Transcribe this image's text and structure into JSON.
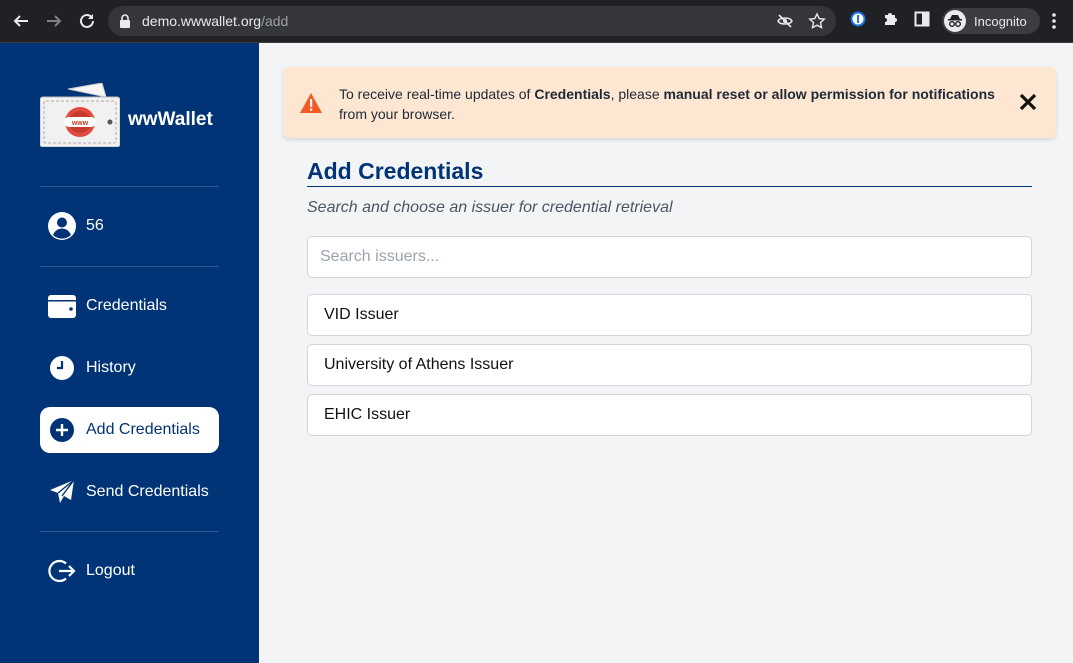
{
  "browser": {
    "url_host": "demo.wwwallet.org",
    "url_path": "/add",
    "incognito_label": "Incognito"
  },
  "sidebar": {
    "logo_text": "www",
    "brand": "wwWallet",
    "user_id": "56",
    "items": [
      {
        "label": "Credentials",
        "icon": "wallet-icon",
        "active": false
      },
      {
        "label": "History",
        "icon": "clock-icon",
        "active": false
      },
      {
        "label": "Add Credentials",
        "icon": "plus-circle-icon",
        "active": true
      },
      {
        "label": "Send Credentials",
        "icon": "paper-plane-icon",
        "active": false
      }
    ],
    "logout_label": "Logout"
  },
  "banner": {
    "text_pre": "To receive real-time updates of ",
    "bold1": "Credentials",
    "text_mid": ", please ",
    "bold2": "manual reset or allow permission for notifications",
    "text_post": " from your browser."
  },
  "main": {
    "title": "Add Credentials",
    "subtitle": "Search and choose an issuer for credential retrieval",
    "search_placeholder": "Search issuers...",
    "issuers": [
      "VID Issuer",
      "University of Athens Issuer",
      "EHIC Issuer"
    ]
  },
  "colors": {
    "sidebar_bg": "#003476",
    "banner_bg": "#fde7d2",
    "warning": "#f15a24",
    "page_bg": "#f3f4f6"
  }
}
